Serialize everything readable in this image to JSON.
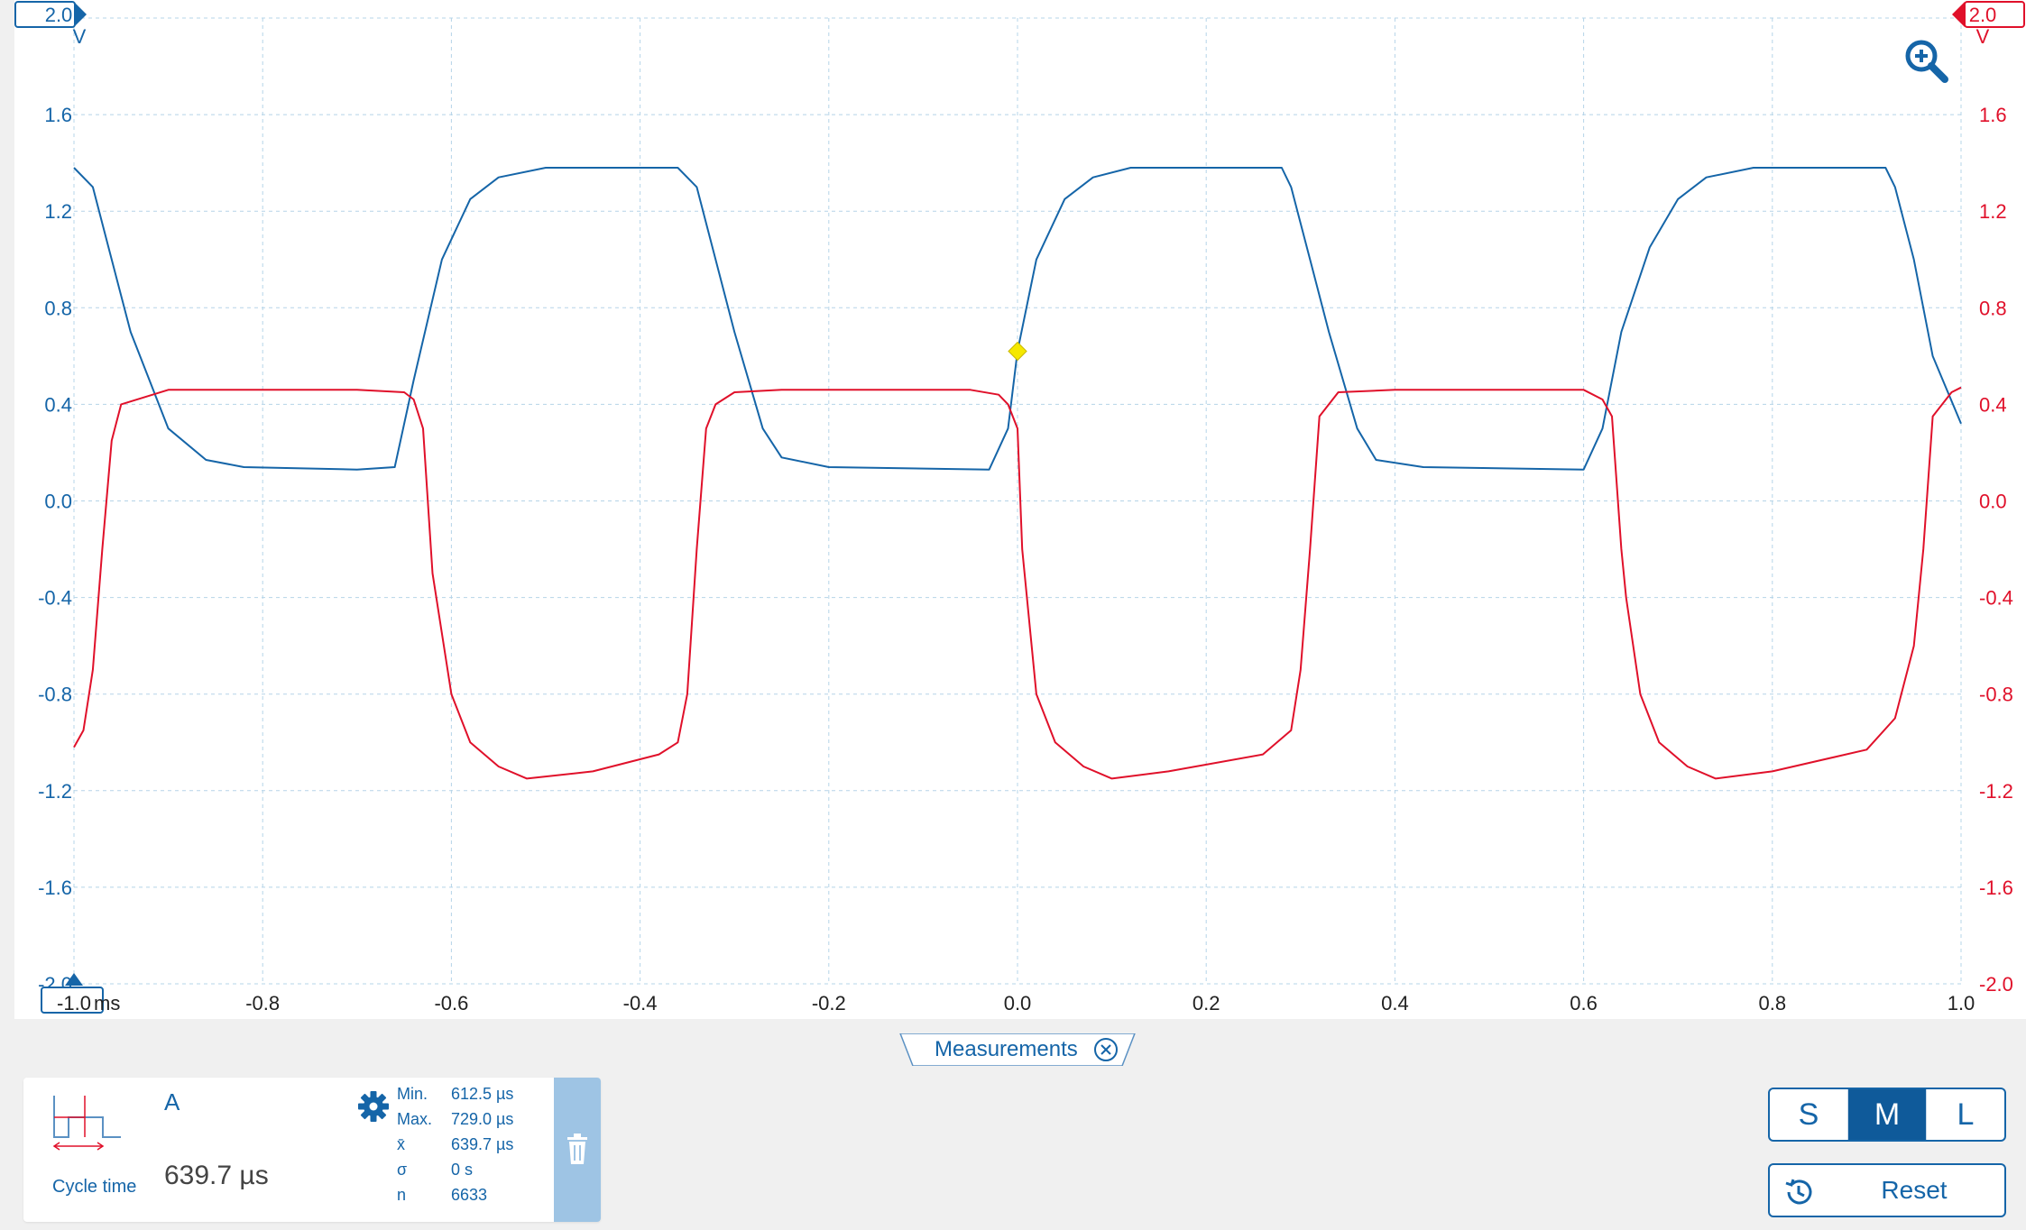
{
  "chart_data": {
    "type": "line",
    "x_unit": "ms",
    "x_range": [
      -1.0,
      1.0
    ],
    "x_ticks": [
      "-1.0",
      "-0.8",
      "-0.6",
      "-0.4",
      "-0.2",
      "0.0",
      "0.2",
      "0.4",
      "0.6",
      "0.8",
      "1.0"
    ],
    "y_left": {
      "range": [
        -2.0,
        2.0
      ],
      "unit": "V",
      "color": "#1565a8",
      "ticks": [
        "2.0",
        "1.6",
        "1.2",
        "0.8",
        "0.4",
        "0.0",
        "-0.4",
        "-0.8",
        "-1.2",
        "-1.6",
        "-2.0"
      ]
    },
    "y_right": {
      "range": [
        -2.0,
        2.0
      ],
      "unit": "V",
      "color": "#e0102a",
      "ticks": [
        "2.0",
        "1.6",
        "1.2",
        "0.8",
        "0.4",
        "0.0",
        "-0.4",
        "-0.8",
        "-1.2",
        "-1.6",
        "-2.0"
      ]
    },
    "grid": true,
    "trigger": {
      "x": 0.0,
      "y": 0.62,
      "color": "#f5e800"
    },
    "series": [
      {
        "channel": "A",
        "color": "#1565a8",
        "axis": "left",
        "x": [
          -1.0,
          -0.98,
          -0.96,
          -0.94,
          -0.9,
          -0.86,
          -0.82,
          -0.7,
          -0.66,
          -0.64,
          -0.61,
          -0.58,
          -0.55,
          -0.5,
          -0.36,
          -0.34,
          -0.32,
          -0.3,
          -0.27,
          -0.25,
          -0.2,
          -0.03,
          -0.01,
          0.0,
          0.02,
          0.05,
          0.08,
          0.12,
          0.28,
          0.29,
          0.31,
          0.33,
          0.36,
          0.38,
          0.43,
          0.6,
          0.62,
          0.64,
          0.67,
          0.7,
          0.73,
          0.78,
          0.92,
          0.93,
          0.95,
          0.97,
          1.0
        ],
        "y": [
          1.38,
          1.3,
          1.0,
          0.7,
          0.3,
          0.17,
          0.14,
          0.13,
          0.14,
          0.5,
          1.0,
          1.25,
          1.34,
          1.38,
          1.38,
          1.3,
          1.0,
          0.7,
          0.3,
          0.18,
          0.14,
          0.13,
          0.3,
          0.62,
          1.0,
          1.25,
          1.34,
          1.38,
          1.38,
          1.3,
          1.0,
          0.7,
          0.3,
          0.17,
          0.14,
          0.13,
          0.3,
          0.7,
          1.05,
          1.25,
          1.34,
          1.38,
          1.38,
          1.3,
          1.0,
          0.6,
          0.32
        ]
      },
      {
        "channel": "B",
        "color": "#e0102a",
        "axis": "right",
        "x": [
          -1.0,
          -0.99,
          -0.98,
          -0.97,
          -0.96,
          -0.95,
          -0.9,
          -0.7,
          -0.65,
          -0.64,
          -0.63,
          -0.62,
          -0.6,
          -0.58,
          -0.55,
          -0.52,
          -0.45,
          -0.38,
          -0.36,
          -0.35,
          -0.34,
          -0.33,
          -0.32,
          -0.3,
          -0.25,
          -0.05,
          -0.02,
          -0.01,
          0.0,
          0.005,
          0.02,
          0.04,
          0.07,
          0.1,
          0.16,
          0.26,
          0.29,
          0.3,
          0.31,
          0.32,
          0.34,
          0.4,
          0.6,
          0.62,
          0.63,
          0.64,
          0.645,
          0.66,
          0.68,
          0.71,
          0.74,
          0.8,
          0.9,
          0.93,
          0.95,
          0.96,
          0.97,
          0.99,
          1.0
        ],
        "y": [
          -1.02,
          -0.95,
          -0.7,
          -0.2,
          0.25,
          0.4,
          0.46,
          0.46,
          0.45,
          0.42,
          0.3,
          -0.3,
          -0.8,
          -1.0,
          -1.1,
          -1.15,
          -1.12,
          -1.05,
          -1.0,
          -0.8,
          -0.2,
          0.3,
          0.4,
          0.45,
          0.46,
          0.46,
          0.44,
          0.4,
          0.3,
          -0.2,
          -0.8,
          -1.0,
          -1.1,
          -1.15,
          -1.12,
          -1.05,
          -0.95,
          -0.7,
          -0.2,
          0.35,
          0.45,
          0.46,
          0.46,
          0.42,
          0.35,
          -0.2,
          -0.4,
          -0.8,
          -1.0,
          -1.1,
          -1.15,
          -1.12,
          -1.03,
          -0.9,
          -0.6,
          -0.2,
          0.35,
          0.45,
          0.47
        ]
      }
    ]
  },
  "scope": {
    "top_left_tag": "2.0",
    "top_right_tag": "2.0",
    "bottom_left_tag": "-1.0",
    "left_unit": "V",
    "right_unit": "V",
    "bottom_left_label": "-2.0",
    "x_unit_label": "ms"
  },
  "measurements_tab": {
    "label": "Measurements"
  },
  "measurement_card": {
    "channel": "A",
    "type_label": "Cycle time",
    "value": "639.7 µs",
    "stats": [
      {
        "label": "Min.",
        "value": "612.5 µs"
      },
      {
        "label": "Max.",
        "value": "729.0 µs"
      },
      {
        "label": "x̄",
        "value": "639.7 µs"
      },
      {
        "label": "σ",
        "value": "0 s"
      },
      {
        "label": "n",
        "value": "6633"
      }
    ]
  },
  "size_selector": {
    "options": [
      "S",
      "M",
      "L"
    ],
    "selected": "M"
  },
  "reset_button": {
    "label": "Reset"
  },
  "icons": {
    "zoom": "zoom-in-icon",
    "close": "close-circle-icon",
    "settings": "gear-icon",
    "delete": "trash-icon",
    "reset": "history-icon",
    "measurement_type": "cycle-time-waveform-icon"
  }
}
